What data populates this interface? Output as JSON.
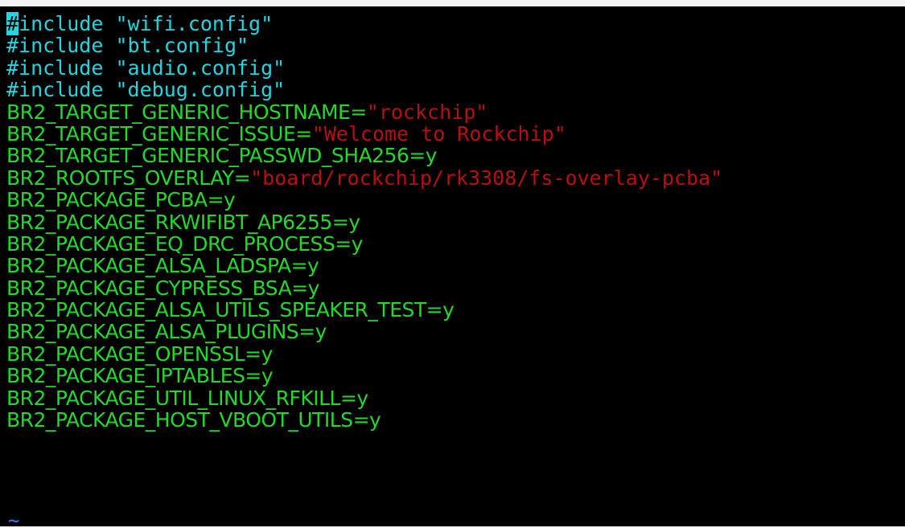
{
  "editor": {
    "includes": [
      {
        "directive": "#include",
        "path": "\"wifi.config\""
      },
      {
        "directive": "#include",
        "path": "\"bt.config\""
      },
      {
        "directive": "#include",
        "path": "\"audio.config\""
      },
      {
        "directive": "#include",
        "path": "\"debug.config\""
      }
    ],
    "hostname_key": "BR2_TARGET_GENERIC_HOSTNAME=",
    "hostname_val": "\"rockchip\"",
    "issue_key": "BR2_TARGET_GENERIC_ISSUE=",
    "issue_val": "\"Welcome to Rockchip\"",
    "passwd_line": "BR2_TARGET_GENERIC_PASSWD_SHA256=y",
    "overlay_key": "BR2_ROOTFS_OVERLAY=",
    "overlay_val": "\"board/rockchip/rk3308/fs-overlay-pcba\"",
    "packages": [
      "BR2_PACKAGE_PCBA=y",
      "BR2_PACKAGE_RKWIFIBT_AP6255=y",
      "BR2_PACKAGE_EQ_DRC_PROCESS=y",
      "BR2_PACKAGE_ALSA_LADSPA=y",
      "BR2_PACKAGE_CYPRESS_BSA=y",
      "BR2_PACKAGE_ALSA_UTILS_SPEAKER_TEST=y",
      "BR2_PACKAGE_ALSA_PLUGINS=y",
      "BR2_PACKAGE_OPENSSL=y",
      "BR2_PACKAGE_IPTABLES=y",
      "BR2_PACKAGE_UTIL_LINUX_RFKILL=y",
      "BR2_PACKAGE_HOST_VBOOT_UTILS=y"
    ],
    "empty_line_marker": "~",
    "colors": {
      "background": "#000000",
      "include": "#21d6e0",
      "key": "#22d82a",
      "string": "#b80f0f",
      "cursor": "#21d6e0"
    }
  }
}
